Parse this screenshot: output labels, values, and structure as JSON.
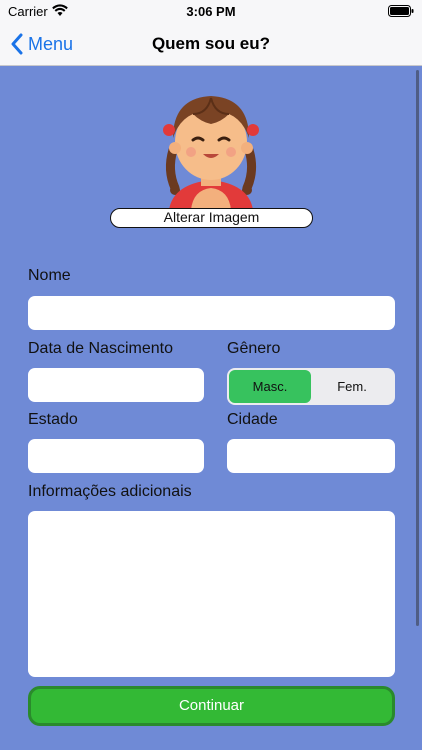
{
  "status_bar": {
    "carrier": "Carrier",
    "time": "3:06 PM"
  },
  "nav": {
    "back_label": "Menu",
    "title": "Quem sou eu?"
  },
  "profile": {
    "change_image_label": "Alterar Imagem"
  },
  "form": {
    "name_label": "Nome",
    "name_value": "",
    "birth_label": "Data de Nascimento",
    "birth_value": "",
    "gender_label": "Gênero",
    "gender_options": [
      "Masc.",
      "Fem."
    ],
    "gender_selected": "Masc.",
    "state_label": "Estado",
    "state_value": "",
    "city_label": "Cidade",
    "city_value": "",
    "info_label": "Informações adicionais",
    "info_value": ""
  },
  "actions": {
    "continue_label": "Continuar"
  },
  "colors": {
    "background": "#6f8ad6",
    "accent_blue": "#1a73e8",
    "selected_segment": "#37c25e",
    "continue_button": "#33b935"
  },
  "icons": {
    "back": "chevron-left-icon",
    "wifi": "wifi-icon",
    "battery": "battery-icon",
    "avatar": "girl-avatar-icon"
  }
}
